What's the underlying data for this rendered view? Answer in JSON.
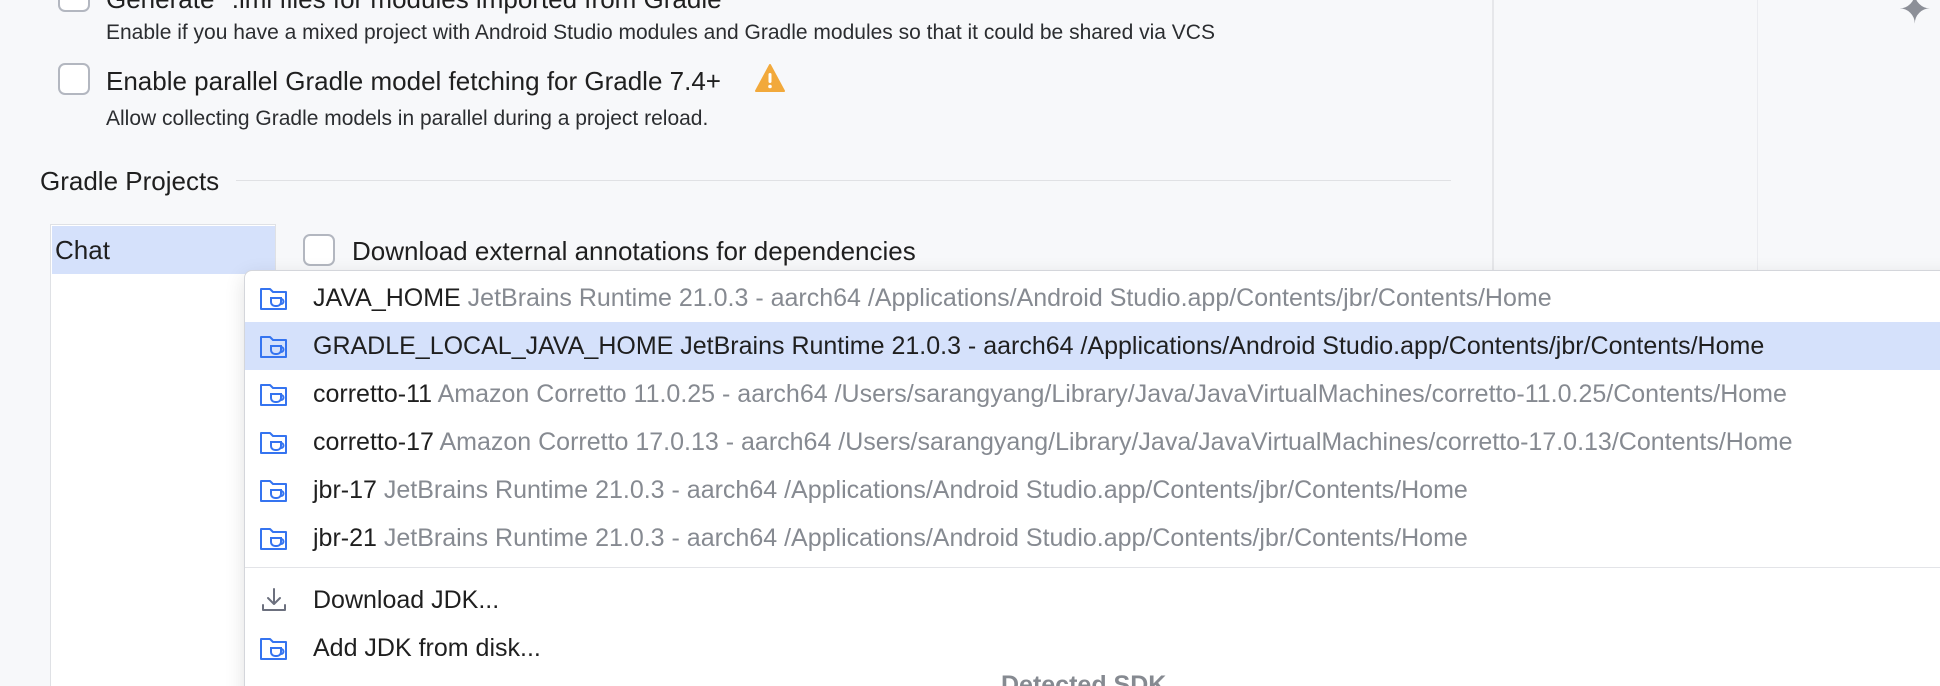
{
  "options": {
    "generate_iml": {
      "label": "Generate *.iml files for modules imported from Gradle",
      "description": "Enable if you have a mixed project with Android Studio modules and Gradle modules so that it could be shared via VCS",
      "checked": false
    },
    "parallel_fetch": {
      "label": "Enable parallel Gradle model fetching for Gradle 7.4+",
      "description": "Allow collecting Gradle models in parallel during a project reload.",
      "checked": false,
      "warning_icon": "warning-icon"
    }
  },
  "gradle_projects": {
    "section_title": "Gradle Projects",
    "projects": [
      {
        "label": "Chat",
        "selected": true
      }
    ],
    "download_annotations": {
      "label": "Download external annotations for dependencies",
      "checked": false
    }
  },
  "jdk_popup": {
    "items": [
      {
        "name": "JAVA_HOME",
        "detail": "JetBrains Runtime 21.0.3 - aarch64 /Applications/Android Studio.app/Contents/jbr/Contents/Home",
        "selected": false,
        "icon": "jdk-folder-icon"
      },
      {
        "name": "GRADLE_LOCAL_JAVA_HOME",
        "detail": "JetBrains Runtime 21.0.3 - aarch64 /Applications/Android Studio.app/Contents/jbr/Contents/Home",
        "selected": true,
        "icon": "jdk-folder-icon"
      },
      {
        "name": "corretto-11",
        "detail": "Amazon Corretto 11.0.25 - aarch64 /Users/sarangyang/Library/Java/JavaVirtualMachines/corretto-11.0.25/Contents/Home",
        "selected": false,
        "icon": "jdk-folder-icon"
      },
      {
        "name": "corretto-17",
        "detail": "Amazon Corretto 17.0.13 - aarch64 /Users/sarangyang/Library/Java/JavaVirtualMachines/corretto-17.0.13/Contents/Home",
        "selected": false,
        "icon": "jdk-folder-icon"
      },
      {
        "name": "jbr-17",
        "detail": "JetBrains Runtime 21.0.3 - aarch64 /Applications/Android Studio.app/Contents/jbr/Contents/Home",
        "selected": false,
        "icon": "jdk-folder-icon"
      },
      {
        "name": "jbr-21",
        "detail": "JetBrains Runtime 21.0.3 - aarch64 /Applications/Android Studio.app/Contents/jbr/Contents/Home",
        "selected": false,
        "icon": "jdk-folder-icon"
      }
    ],
    "actions": [
      {
        "label": "Download JDK...",
        "icon": "download-icon"
      },
      {
        "label": "Add JDK from disk...",
        "icon": "jdk-folder-icon"
      }
    ],
    "footer_group_label": "Detected SDK"
  },
  "colors": {
    "selection": "#d5e1fb",
    "icon_blue": "#3574f0",
    "warning": "#f2a93b",
    "detail_gray": "#868a91"
  }
}
